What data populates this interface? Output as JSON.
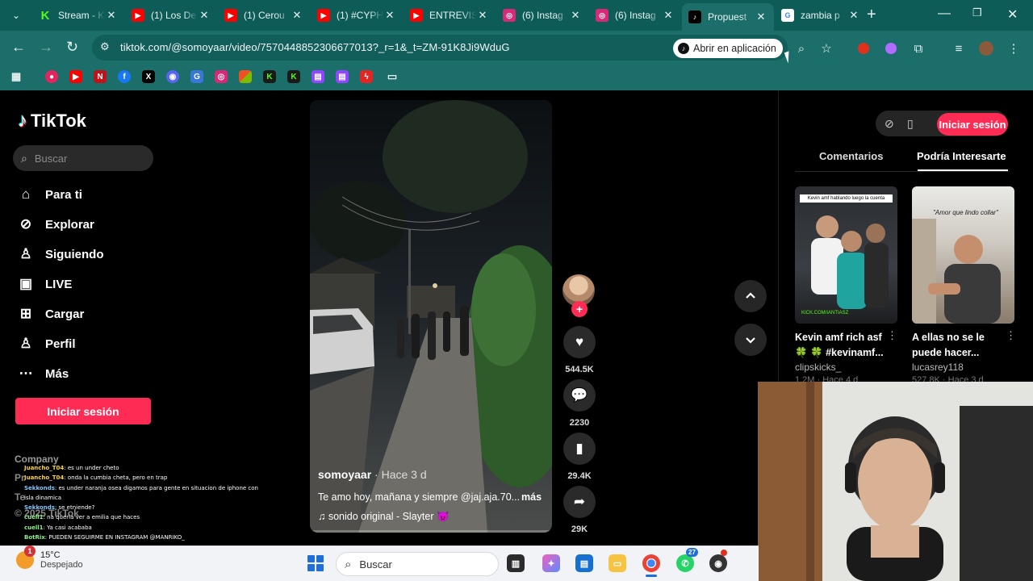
{
  "browser": {
    "tabs": [
      {
        "title": "Stream - Kick",
        "favicon": "kick-icon",
        "color": "#53fc18"
      },
      {
        "title": "(1) Los De",
        "favicon": "youtube-icon",
        "color": "#ff0000"
      },
      {
        "title": "(1) Cerou",
        "favicon": "youtube-icon",
        "color": "#ff0000"
      },
      {
        "title": "(1) #CYPH",
        "favicon": "youtube-icon",
        "color": "#ff0000"
      },
      {
        "title": "ENTREVIS",
        "favicon": "youtube-icon",
        "color": "#ff0000"
      },
      {
        "title": "(6) Instag",
        "favicon": "instagram-icon",
        "color": "#d62976"
      },
      {
        "title": "(6) Instag",
        "favicon": "instagram-icon",
        "color": "#d62976"
      },
      {
        "title": "Propuest",
        "favicon": "tiktok-icon",
        "color": "#000000"
      },
      {
        "title": "zambia p",
        "favicon": "google-icon",
        "color": "#4285f4"
      }
    ],
    "url": "tiktok.com/@somoyaar/video/7570448852306677013?_r=1&_t=ZM-91K8Ji9WduG",
    "open_in_app": "Abrir en aplicación"
  },
  "tiktok": {
    "brand": "TikTok",
    "search_placeholder": "Buscar",
    "nav": [
      {
        "label": "Para ti",
        "icon": "home-icon"
      },
      {
        "label": "Explorar",
        "icon": "compass-icon"
      },
      {
        "label": "Siguiendo",
        "icon": "following-icon"
      },
      {
        "label": "LIVE",
        "icon": "live-icon"
      },
      {
        "label": "Cargar",
        "icon": "upload-icon"
      },
      {
        "label": "Perfil",
        "icon": "profile-icon"
      },
      {
        "label": "Más",
        "icon": "more-icon"
      }
    ],
    "login_label": "Iniciar sesión",
    "footer_company": "Company",
    "footer_partial": [
      "Pr",
      "Te",
      "© 2025 TikTok"
    ],
    "video": {
      "author": "somoyaar",
      "ago": "· Hace 3 d",
      "caption": "Te amo hoy, mañana y siempre @jaj.aja.70...",
      "more": "más",
      "sound": "sonido original - Slayter 😈"
    },
    "actions": {
      "likes": "544.5K",
      "comments": "2230",
      "saves": "29.4K",
      "shares": "29K"
    },
    "right_panel": {
      "login": "Iniciar sesión",
      "tab_comments": "Comentarios",
      "tab_interest": "Podría Interesarte",
      "cards": [
        {
          "title": "Kevin amf rich asf 🍀 🍀 #kevinamf...",
          "author": "clipskicks_",
          "meta": "1.2M · Hace 4 d",
          "overlay": "Kevin amf hablando luego la cuenta",
          "overlay2": "KICK.COM/IANTIASZ"
        },
        {
          "title": "A ellas no se le puede hacer...",
          "author": "lucasrey118",
          "meta": "527.8K · Hace 3 d",
          "overlay": "\"Amor que lindo collar\""
        }
      ]
    }
  },
  "chat": [
    {
      "user": "Juancho_T04",
      "msg": ": es un under cheto",
      "c": "y"
    },
    {
      "user": "Juancho_T04",
      "msg": ": onda la cumbia cheta, pero en trap",
      "c": "y"
    },
    {
      "user": "Sekkonds",
      "msg": ": es under naranja osea digamos para gente en situacion de iphone con isla dinamica",
      "c": "b"
    },
    {
      "user": "Sekkonds",
      "msg": ": se etniende?",
      "c": "b"
    },
    {
      "user": "cuell1",
      "msg": ": na queria ver a emilia que haces",
      "c": "g"
    },
    {
      "user": "cuell1",
      "msg": ": Ya casi acababa",
      "c": "g"
    },
    {
      "user": "BotRix",
      "msg": ": PUEDEN SEGUIRME EN INSTAGRAM @MANRIKO_",
      "c": "g"
    }
  ],
  "taskbar": {
    "temp": "15°C",
    "weather": "Despejado",
    "weather_badge": "1",
    "search": "Buscar",
    "whatsapp_badge": "27"
  }
}
